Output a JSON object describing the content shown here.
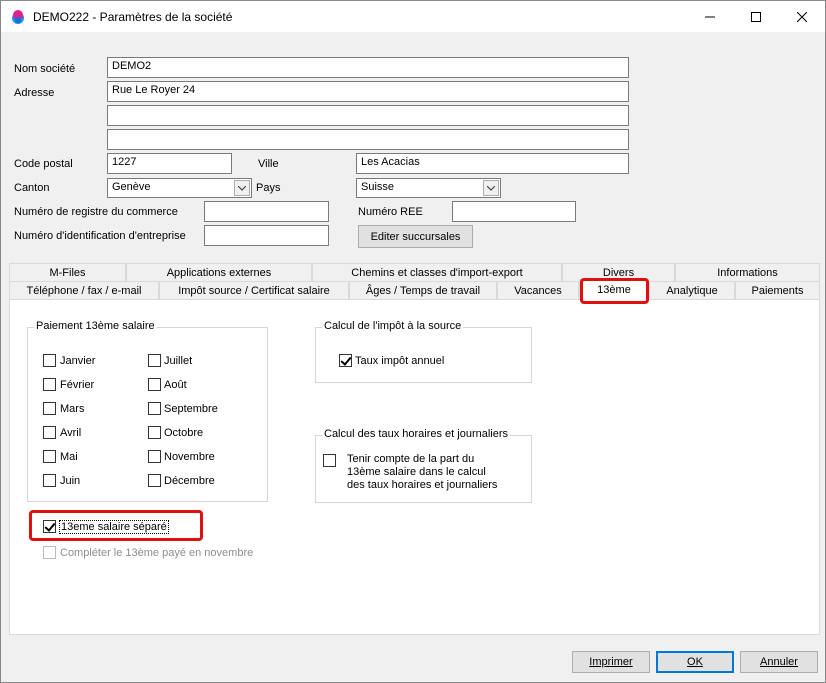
{
  "window": {
    "title": "DEMO222 - Paramètres de la société",
    "minimize_icon": "minimize-icon",
    "maximize_icon": "maximize-icon",
    "close_icon": "close-icon"
  },
  "form": {
    "nom_label": "Nom société",
    "nom_value": "DEMO2",
    "adresse_label": "Adresse",
    "adresse1": "Rue Le Royer 24",
    "adresse2": "",
    "adresse3": "",
    "cp_label": "Code postal",
    "cp_value": "1227",
    "ville_label": "Ville",
    "ville_value": "Les Acacias",
    "canton_label": "Canton",
    "canton_value": "Genève",
    "pays_label": "Pays",
    "pays_value": "Suisse",
    "rc_label": "Numéro de registre du commerce",
    "rc_value": "",
    "ree_label": "Numéro REE",
    "ree_value": "",
    "ide_label": "Numéro d'identification d'entreprise",
    "ide_value": "",
    "succursales_button": "Editer succursales"
  },
  "tabs_row1": [
    "M-Files",
    "Applications externes",
    "Chemins et classes d'import-export",
    "Divers",
    "Informations"
  ],
  "tabs_row2": [
    "Téléphone / fax / e-mail",
    "Impôt source / Certificat salaire",
    "Âges / Temps de travail",
    "Vacances",
    "13ème",
    "Analytique",
    "Paiements"
  ],
  "active_tab": "13ème",
  "paiement": {
    "title": "Paiement 13ème salaire",
    "months": [
      {
        "label": "Janvier",
        "checked": false
      },
      {
        "label": "Février",
        "checked": false
      },
      {
        "label": "Mars",
        "checked": false
      },
      {
        "label": "Avril",
        "checked": false
      },
      {
        "label": "Mai",
        "checked": false
      },
      {
        "label": "Juin",
        "checked": false
      },
      {
        "label": "Juillet",
        "checked": false
      },
      {
        "label": "Août",
        "checked": false
      },
      {
        "label": "Septembre",
        "checked": false
      },
      {
        "label": "Octobre",
        "checked": false
      },
      {
        "label": "Novembre",
        "checked": false
      },
      {
        "label": "Décembre",
        "checked": false
      }
    ]
  },
  "impot": {
    "title": "Calcul  de l'impôt à la source",
    "taux_label": "Taux impôt annuel",
    "taux_checked": true
  },
  "horaires": {
    "title": "Calcul des taux horaires et journaliers",
    "line1": "Tenir compte de la part du",
    "line2": "13ème salaire dans le calcul",
    "line3": "des taux horaires et journaliers",
    "checked": false
  },
  "separe": {
    "label": "13eme salaire séparé",
    "checked": true
  },
  "novembre": {
    "label": "Compléter le 13ème payé en novembre",
    "checked": false,
    "disabled": true
  },
  "buttons": {
    "imprimer": "Imprimer",
    "ok": "OK",
    "annuler": "Annuler"
  },
  "colors": {
    "highlight": "#e01010",
    "ok_border": "#0078d7"
  }
}
